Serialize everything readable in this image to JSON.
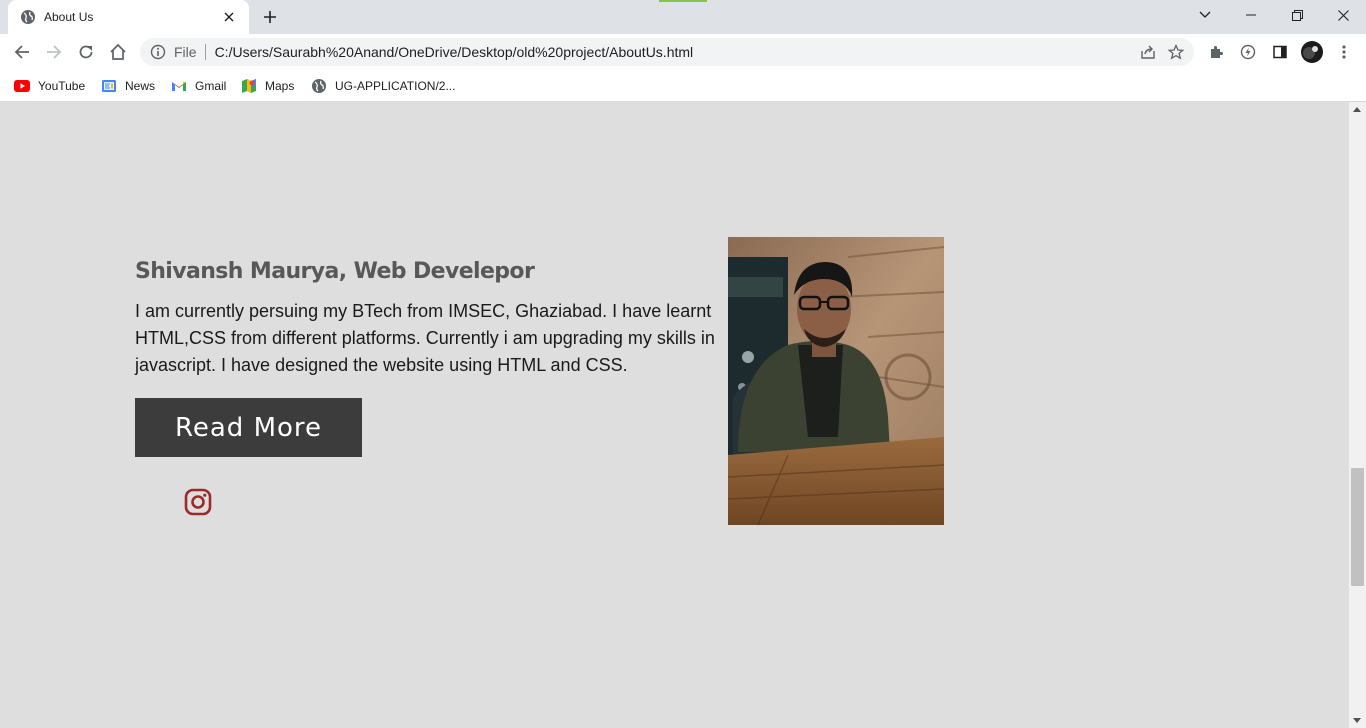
{
  "browser": {
    "tab_title": "About Us",
    "address_scheme": "File",
    "address_url": "C:/Users/Saurabh%20Anand/OneDrive/Desktop/old%20project/AboutUs.html",
    "bookmarks": [
      {
        "label": "YouTube",
        "icon": "youtube-icon"
      },
      {
        "label": "News",
        "icon": "google-news-icon"
      },
      {
        "label": "Gmail",
        "icon": "gmail-icon"
      },
      {
        "label": "Maps",
        "icon": "maps-icon"
      },
      {
        "label": "UG-APPLICATION/2...",
        "icon": "globe-icon"
      }
    ]
  },
  "page": {
    "author_heading": "Shivansh Maurya, Web Develepor",
    "bio": "I am currently persuing my BTech from IMSEC, Ghaziabad. I have learnt HTML,CSS from different platforms. Currently i am upgrading my skills in javascript. I have designed the website using HTML and CSS.",
    "read_more_label": "Read More",
    "social_icon": "instagram-icon",
    "photo_alt": "portrait-photo"
  },
  "colors": {
    "page_background": "#dedede",
    "button_background": "#3c3c3c",
    "heading_text": "#585858",
    "instagram": "#9c2a2a"
  }
}
